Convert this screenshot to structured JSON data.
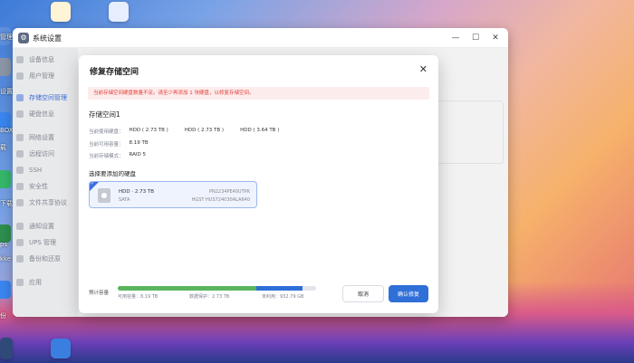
{
  "colors": {
    "accent": "#2f6fd8",
    "used": "#5ab55e",
    "warning_bg": "#fdecec",
    "warning_text": "#e0413a"
  },
  "dock": {
    "labels": [
      "管理",
      "设置",
      "BOX",
      "载",
      "器",
      "下载",
      "ps",
      "kke",
      "份"
    ]
  },
  "window": {
    "title": "系统设置",
    "controls": {
      "minimize": "—",
      "maximize": "☐",
      "close": "✕"
    }
  },
  "sidebar": {
    "items": [
      {
        "label": "设备信息",
        "icon": "device-icon"
      },
      {
        "label": "用户管理",
        "icon": "user-icon"
      },
      {
        "label": "存储空间管理",
        "icon": "storage-icon"
      },
      {
        "label": "硬盘信息",
        "icon": "disk-icon"
      },
      {
        "label": "网络设置",
        "icon": "network-icon"
      },
      {
        "label": "远程访问",
        "icon": "remote-icon"
      },
      {
        "label": "SSH",
        "icon": "ssh-icon"
      },
      {
        "label": "安全性",
        "icon": "security-icon"
      },
      {
        "label": "文件共享协议",
        "icon": "share-icon"
      },
      {
        "label": "通知设置",
        "icon": "notification-icon"
      },
      {
        "label": "UPS 管理",
        "icon": "ups-icon"
      },
      {
        "label": "备份和还原",
        "icon": "backup-icon"
      },
      {
        "label": "应用",
        "icon": "apps-icon"
      }
    ]
  },
  "modal": {
    "title": "修复存储空间",
    "close": "✕",
    "warning": "当前存储空间硬盘数量不足。请至少再添加 1 块硬盘，以修复存储空间。",
    "storage_name": "存储空间1",
    "current_disks_label": "当前使用硬盘：",
    "current_disks": [
      "HDD ( 2.73 TB )",
      "HDD ( 2.73 TB )",
      "HDD ( 3.64 TB )"
    ],
    "available_label": "当前可用容量：",
    "available": "8.19 TB",
    "mode_label": "当前存储模式：",
    "mode": "RAID 5",
    "select_title": "选择要添加的硬盘",
    "disk": {
      "name": "HDD · 2.73 TB",
      "type": "SATA",
      "serial": "PN2234PE40UTPK",
      "model": "HGST HUS724030ALA640"
    },
    "estimate_label": "预计容量",
    "capacity": {
      "used_fraction": 0.7,
      "estimate_fraction": 0.23,
      "available_text": "可用容量：8.19 TB",
      "estimate_text": "数据保护：2.73 TB",
      "unused_text": "未利用：932.79 GB"
    },
    "cancel": "取消",
    "confirm": "确认修复"
  }
}
